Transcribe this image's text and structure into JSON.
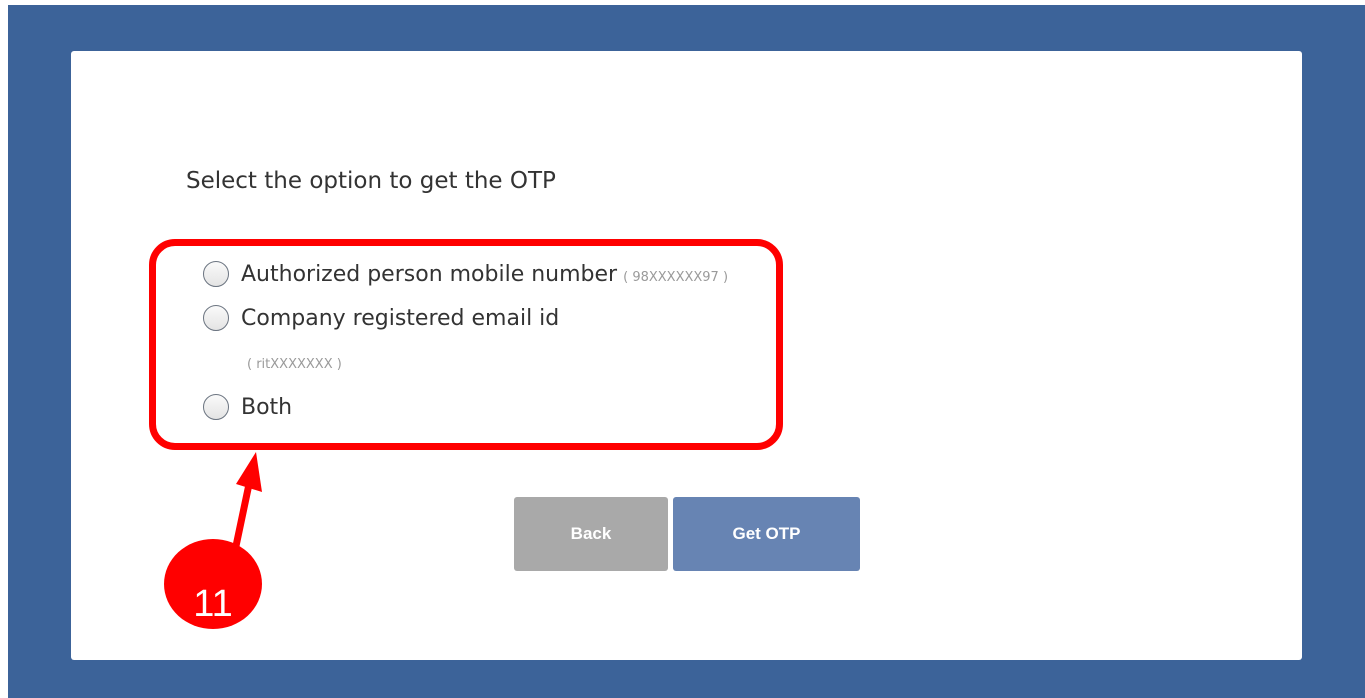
{
  "otp_form": {
    "prompt": "Select the option to get the OTP",
    "options": [
      {
        "label": "Authorized person mobile number",
        "hint": "( 98XXXXXX97 )",
        "selected": false
      },
      {
        "label": "Company registered email id",
        "hint": "( ritXXXXXXX )",
        "selected": false
      },
      {
        "label": "Both",
        "selected": false
      }
    ],
    "back_label": "Back",
    "get_otp_label": "Get OTP"
  },
  "annotation": {
    "step_number": "11",
    "color": "#ff0000"
  },
  "colors": {
    "page_background": "#3c6399",
    "card_background": "#ffffff",
    "back_button": "#a9a9a9",
    "get_otp_button": "#6784b3"
  },
  "icons": [
    "radio-icon",
    "arrow-icon"
  ]
}
